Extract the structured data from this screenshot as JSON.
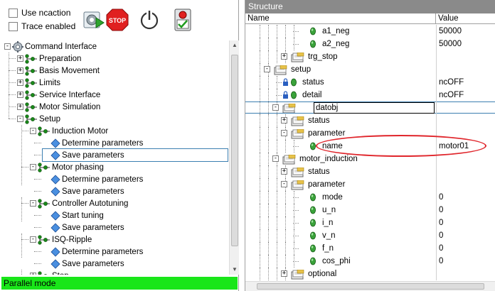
{
  "left": {
    "use_ncaction_label": "Use ncaction",
    "trace_enabled_label": "Trace enabled",
    "toolbar": [
      {
        "name": "run-settings-icon"
      },
      {
        "name": "stop-icon",
        "label": "STOP"
      },
      {
        "name": "power-icon"
      },
      {
        "name": "check-status-icon"
      }
    ],
    "tree": [
      {
        "label": "Command Interface",
        "level": 0,
        "exp": "-",
        "icon": "gear"
      },
      {
        "label": "Preparation",
        "level": 1,
        "exp": "+",
        "icon": "node"
      },
      {
        "label": "Basis Movement",
        "level": 1,
        "exp": "+",
        "icon": "node"
      },
      {
        "label": "Limits",
        "level": 1,
        "exp": "+",
        "icon": "node"
      },
      {
        "label": "Service Interface",
        "level": 1,
        "exp": "+",
        "icon": "node"
      },
      {
        "label": "Motor Simulation",
        "level": 1,
        "exp": "+",
        "icon": "node"
      },
      {
        "label": "Setup",
        "level": 1,
        "exp": "-",
        "icon": "node"
      },
      {
        "label": "Induction Motor",
        "level": 2,
        "exp": "-",
        "icon": "node"
      },
      {
        "label": "Determine parameters",
        "level": 3,
        "exp": "",
        "icon": "diamond"
      },
      {
        "label": "Save parameters",
        "level": 3,
        "exp": "",
        "icon": "diamond",
        "selected": true
      },
      {
        "label": "Motor phasing",
        "level": 2,
        "exp": "-",
        "icon": "node"
      },
      {
        "label": "Determine parameters",
        "level": 3,
        "exp": "",
        "icon": "diamond"
      },
      {
        "label": "Save parameters",
        "level": 3,
        "exp": "",
        "icon": "diamond"
      },
      {
        "label": "Controller Autotuning",
        "level": 2,
        "exp": "-",
        "icon": "node"
      },
      {
        "label": "Start tuning",
        "level": 3,
        "exp": "",
        "icon": "diamond"
      },
      {
        "label": "Save parameters",
        "level": 3,
        "exp": "",
        "icon": "diamond"
      },
      {
        "label": "ISQ-Ripple",
        "level": 2,
        "exp": "-",
        "icon": "node"
      },
      {
        "label": "Determine parameters",
        "level": 3,
        "exp": "",
        "icon": "diamond"
      },
      {
        "label": "Save parameters",
        "level": 3,
        "exp": "",
        "icon": "diamond"
      },
      {
        "label": "Stop",
        "level": 2,
        "exp": "+",
        "icon": "node"
      }
    ],
    "status": "Parallel mode",
    "status_color": "#19e619"
  },
  "right": {
    "title": "Structure",
    "col_name": "Name",
    "col_value": "Value",
    "rows": [
      {
        "name": "a1_neg",
        "value": "50000",
        "indent": 6,
        "icon": "leaf",
        "exp": ""
      },
      {
        "name": "a2_neg",
        "value": "50000",
        "indent": 6,
        "icon": "leaf",
        "exp": ""
      },
      {
        "name": "trg_stop",
        "value": "",
        "indent": 5,
        "icon": "folder",
        "exp": "+"
      },
      {
        "name": "setup",
        "value": "",
        "indent": 3,
        "icon": "folder",
        "exp": "-"
      },
      {
        "name": "status",
        "value": "ncOFF",
        "indent": 4,
        "icon": "lockleaf",
        "exp": ""
      },
      {
        "name": "detail",
        "value": "ncOFF",
        "indent": 4,
        "icon": "lockleaf",
        "exp": ""
      },
      {
        "name": "",
        "value": "",
        "indent": 4,
        "icon": "folder",
        "exp": "-",
        "editing": true
      },
      {
        "name": "status",
        "value": "",
        "indent": 5,
        "icon": "folder",
        "exp": "+"
      },
      {
        "name": "parameter",
        "value": "",
        "indent": 5,
        "icon": "folder",
        "exp": "-"
      },
      {
        "name": "name",
        "value": "motor01",
        "indent": 6,
        "icon": "leaf",
        "exp": ""
      },
      {
        "name": "motor_induction",
        "value": "",
        "indent": 4,
        "icon": "folder",
        "exp": "-"
      },
      {
        "name": "status",
        "value": "",
        "indent": 5,
        "icon": "folder",
        "exp": "+"
      },
      {
        "name": "parameter",
        "value": "",
        "indent": 5,
        "icon": "folder",
        "exp": "-"
      },
      {
        "name": "mode",
        "value": "0",
        "indent": 6,
        "icon": "leaf",
        "exp": ""
      },
      {
        "name": "u_n",
        "value": "0",
        "indent": 6,
        "icon": "leaf",
        "exp": ""
      },
      {
        "name": "i_n",
        "value": "0",
        "indent": 6,
        "icon": "leaf",
        "exp": ""
      },
      {
        "name": "v_n",
        "value": "0",
        "indent": 6,
        "icon": "leaf",
        "exp": ""
      },
      {
        "name": "f_n",
        "value": "0",
        "indent": 6,
        "icon": "leaf",
        "exp": ""
      },
      {
        "name": "cos_phi",
        "value": "0",
        "indent": 6,
        "icon": "leaf",
        "exp": ""
      },
      {
        "name": "optional",
        "value": "",
        "indent": 5,
        "icon": "folder",
        "exp": "+"
      }
    ],
    "edit_value": "datobj",
    "highlight_color": "#e0262c"
  }
}
